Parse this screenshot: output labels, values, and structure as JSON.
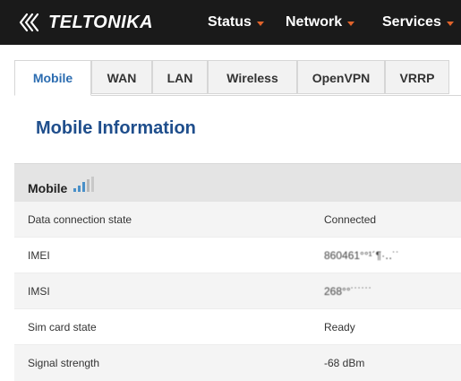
{
  "brand": {
    "logo_text": "TELTONIKA"
  },
  "nav": [
    {
      "label": "Status"
    },
    {
      "label": "Network"
    },
    {
      "label": "Services"
    }
  ],
  "tabs": [
    {
      "label": "Mobile",
      "active": true
    },
    {
      "label": "WAN"
    },
    {
      "label": "LAN"
    },
    {
      "label": "Wireless"
    },
    {
      "label": "OpenVPN"
    },
    {
      "label": "VRRP"
    }
  ],
  "page": {
    "title": "Mobile Information"
  },
  "section": {
    "title": "Mobile",
    "icon": "signal-strength-icon"
  },
  "rows": [
    {
      "label": "Data connection state",
      "value": "Connected"
    },
    {
      "label": "IMEI",
      "value": "860461°°¹´¶·‥˙˙"
    },
    {
      "label": "IMSI",
      "value": "268°°˙˙˙˙˙˙"
    },
    {
      "label": "Sim card state",
      "value": "Ready"
    },
    {
      "label": "Signal strength",
      "value": "-68 dBm"
    }
  ],
  "colors": {
    "header_bg": "#1a1a1a",
    "accent_orange": "#e0632b",
    "title_blue": "#1f4e8c",
    "tab_active_blue": "#2b6cb0"
  }
}
